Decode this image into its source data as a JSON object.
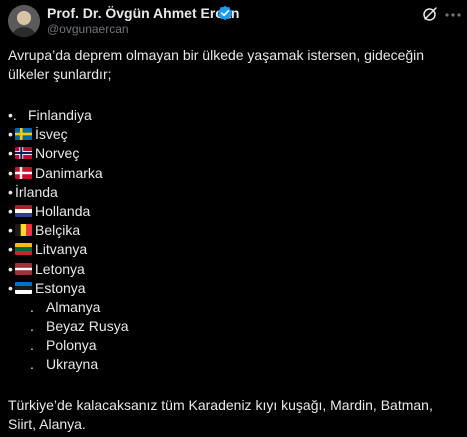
{
  "author": {
    "name": "Prof. Dr. Övgün Ahmet Ercan",
    "handle": "@ovgunaercan",
    "verified_icon": "verified-badge-icon"
  },
  "actions": {
    "grok_icon": "grok-icon",
    "more_icon": "more-icon"
  },
  "tweet": {
    "intro": "Avrupa’da deprem olmayan bir ülkede yaşamak istersen, gideceğin ülkeler şunlardır;",
    "countries": [
      {
        "bullet": "•.",
        "flag": "",
        "label": "Finlandiya"
      },
      {
        "bullet": "•",
        "flag": "sweden",
        "label": "İsveç"
      },
      {
        "bullet": "•",
        "flag": "norway",
        "label": "Norveç"
      },
      {
        "bullet": "•",
        "flag": "denmark",
        "label": "Danimarka"
      },
      {
        "bullet": "•",
        "flag": "",
        "label": "İrlanda"
      },
      {
        "bullet": "•",
        "flag": "netherlands",
        "label": "Hollanda"
      },
      {
        "bullet": "•",
        "flag": "belgium",
        "label": "Belçika"
      },
      {
        "bullet": "•",
        "flag": "lithuania",
        "label": "Litvanya"
      },
      {
        "bullet": "•",
        "flag": "latvia",
        "label": "Letonya"
      },
      {
        "bullet": "•",
        "flag": "estonia",
        "label": "Estonya"
      }
    ],
    "sub_countries": [
      {
        "bullet": ".",
        "label": "Almanya"
      },
      {
        "bullet": ".",
        "label": "Beyaz Rusya"
      },
      {
        "bullet": ".",
        "label": "Polonya"
      },
      {
        "bullet": ".",
        "label": "Ukrayna"
      }
    ],
    "closing": "Türkiye’de kalacaksanız tüm Karadeniz kıyı kuşağı, Mardin, Batman, Siirt, Alanya."
  },
  "colors": {
    "background": "#000000",
    "text": "#e7e9ea",
    "secondary": "#71767b",
    "verified": "#1d9bf0"
  }
}
